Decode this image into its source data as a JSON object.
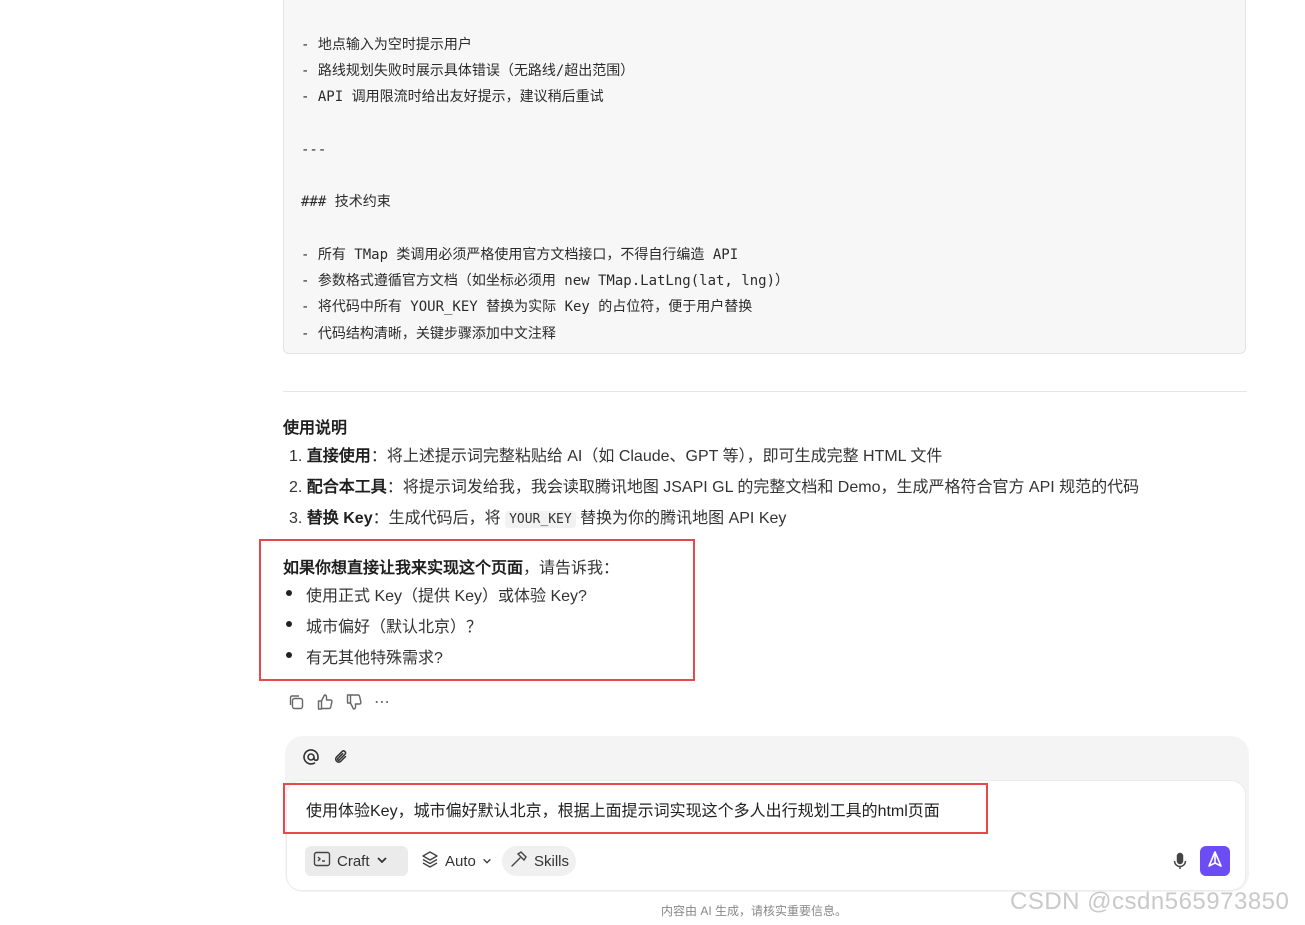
{
  "code_block": {
    "lines": [
      "- 地点输入为空时提示用户",
      "- 路线规划失败时展示具体错误（无路线/超出范围）",
      "- API 调用限流时给出友好提示，建议稍后重试",
      "---",
      "### 技术约束",
      "- 所有 TMap 类调用必须严格使用官方文档接口，不得自行编造 API",
      "- 参数格式遵循官方文档（如坐标必须用 new TMap.LatLng(lat, lng)）",
      "- 将代码中所有 YOUR_KEY 替换为实际 Key 的占位符，便于用户替换",
      "- 代码结构清晰，关键步骤添加中文注释"
    ]
  },
  "usage": {
    "title": "使用说明",
    "items": [
      {
        "num": "1.",
        "bold": "直接使用",
        "text": "：将上述提示词完整粘贴给 AI（如 Claude、GPT 等），即可生成完整 HTML 文件"
      },
      {
        "num": "2.",
        "bold": "配合本工具",
        "text": "：将提示词发给我，我会读取腾讯地图 JSAPI GL 的完整文档和 Demo，生成严格符合官方 API 规范的代码"
      },
      {
        "num": "3.",
        "bold": "替换 Key",
        "text_before": "：生成代码后，将 ",
        "code": "YOUR_KEY",
        "text_after": " 替换为你的腾讯地图 API Key"
      }
    ]
  },
  "question": {
    "bold": "如果你想直接让我来实现这个页面",
    "rest": "，请告诉我：",
    "bullets": [
      "使用正式 Key（提供 Key）或体验 Key?",
      "城市偏好（默认北京）？",
      "有无其他特殊需求?"
    ]
  },
  "actions": {
    "copy": "copy-icon",
    "like": "thumbs-up-icon",
    "dislike": "thumbs-down-icon",
    "more": "⋯"
  },
  "composer": {
    "input_value": "使用体验Key，城市偏好默认北京，根据上面提示词实现这个多人出行规划工具的html页面",
    "mode_label": "Craft",
    "model_label": "Auto",
    "skills_label": "Skills"
  },
  "footer": {
    "note": "内容由 AI 生成，请核实重要信息。"
  },
  "watermark": "CSDN @csdn565973850",
  "colors": {
    "accent": "#6c4cf5",
    "highlight_border": "#e5484d"
  }
}
